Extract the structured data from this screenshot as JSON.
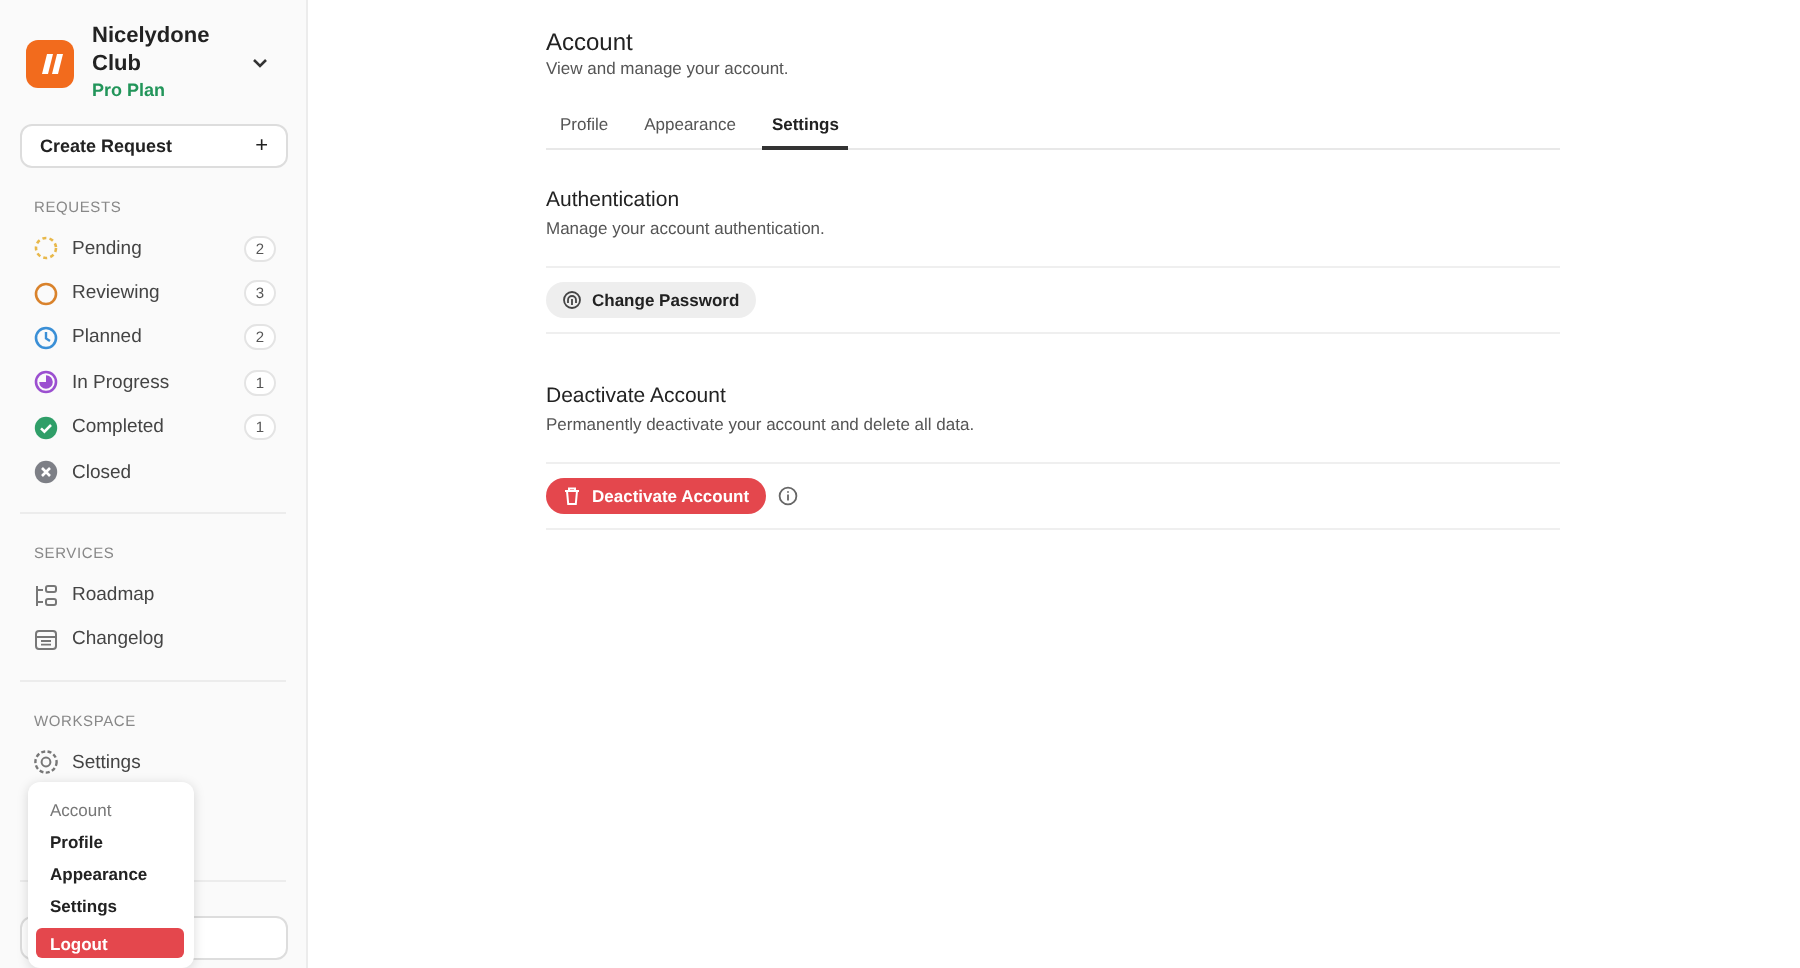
{
  "workspace": {
    "name": "Nicelydone Club",
    "plan": "Pro Plan"
  },
  "create_button": {
    "label": "Create Request",
    "icon": "+"
  },
  "sections": [
    {
      "title": "REQUESTS",
      "items": [
        {
          "label": "Pending",
          "kind": "pending",
          "count": "2"
        },
        {
          "label": "Reviewing",
          "kind": "reviewing",
          "count": "3"
        },
        {
          "label": "Planned",
          "kind": "planned",
          "count": "2"
        },
        {
          "label": "In Progress",
          "kind": "progress",
          "count": "1"
        },
        {
          "label": "Completed",
          "kind": "completed",
          "count": "1"
        },
        {
          "label": "Closed",
          "kind": "closed"
        }
      ]
    },
    {
      "title": "SERVICES",
      "items": [
        {
          "label": "Roadmap",
          "kind": "roadmap"
        },
        {
          "label": "Changelog",
          "kind": "changelog"
        }
      ]
    },
    {
      "title": "WORKSPACE",
      "items": [
        {
          "label": "Settings",
          "kind": "settings"
        }
      ]
    }
  ],
  "menu": {
    "heading": "Account",
    "items": [
      "Profile",
      "Appearance",
      "Settings"
    ],
    "logout": "Logout"
  },
  "page": {
    "title": "Account",
    "subtitle": "View and manage your account."
  },
  "tabs": [
    {
      "label": "Profile",
      "selected": false
    },
    {
      "label": "Appearance",
      "selected": false
    },
    {
      "label": "Settings",
      "selected": true
    }
  ],
  "panels": [
    {
      "title": "Authentication",
      "description": "Manage your account authentication.",
      "button": {
        "label": "Change Password",
        "kind": "neutral"
      }
    },
    {
      "title": "Deactivate Account",
      "description": "Permanently deactivate your account and delete all data.",
      "button": {
        "label": "Deactivate Account",
        "kind": "danger"
      },
      "info": true
    }
  ]
}
